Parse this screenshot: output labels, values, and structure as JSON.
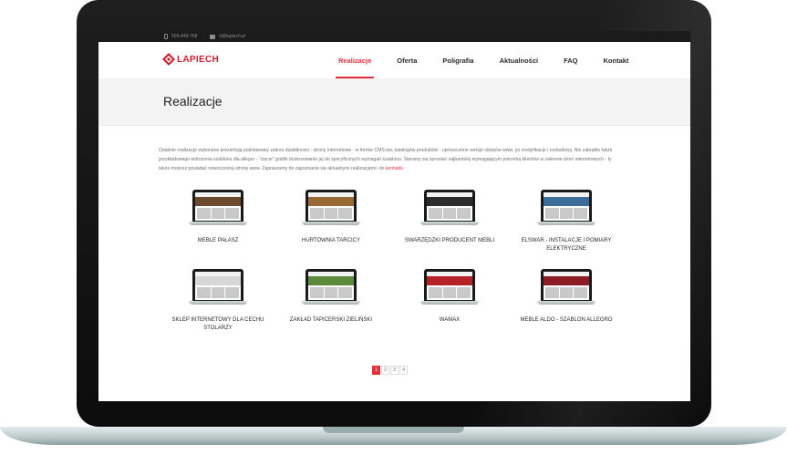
{
  "topbar": {
    "phone": "503-449-768",
    "email": "it@lapiech.pl"
  },
  "logo": {
    "text": "LAPIECH"
  },
  "nav": [
    {
      "label": "Realizacje",
      "active": true
    },
    {
      "label": "Oferta",
      "active": false
    },
    {
      "label": "Poligrafia",
      "active": false
    },
    {
      "label": "Aktualności",
      "active": false
    },
    {
      "label": "FAQ",
      "active": false
    },
    {
      "label": "Kontakt",
      "active": false
    }
  ],
  "page": {
    "title": "Realizacje",
    "intro": "Ostatnie realizacje wykonane prezentują podstawowy zakres działalności - strony internetowe - w formie CMS-ów, katalogów produktów - uproszczone wersje sklepów www, po modyfikacje i rozbudowy. Nie zabrakło także przykładowego wdrożenia szablonu dla allegro - \"cięcie\" grafiki dostosowanie jej do specyficznych wymagań szablonu. Staramy się sprostać najbardziej wymagającym potrzebą klientów w zakresie stron internetowych - ty także możesz posiadać nowoczesną stronę www. Zapraszamy do zapoznania się aktualnymi realizacjami i do",
    "intro_link": "kontaktu",
    "intro_end": "."
  },
  "projects": [
    {
      "label": "MEBLE PAŁASZ",
      "band": "#6b4a2e"
    },
    {
      "label": "HURTOWNIA TARCICY",
      "band": "#9a6a35"
    },
    {
      "label": "SWARZĘDZKI PRODUCENT MEBLI",
      "band": "#2b2b2b"
    },
    {
      "label": "ELSWAR - INSTALACJE I POMIARY ELEKTRYCZNE",
      "band": "#3d6d9a"
    },
    {
      "label": "SKLEP INTERNETOWY DLA CECHU STOLARZY",
      "band": "#d7d7d7"
    },
    {
      "label": "ZAKŁAD TAPICERSKI ZIELIŃSKI",
      "band": "#5b8a3a"
    },
    {
      "label": "WAMAX",
      "band": "#b42126"
    },
    {
      "label": "MEBLE ALDO - SZABLON ALLEGRO",
      "band": "#8c1d22"
    }
  ],
  "pagination": [
    "1",
    "2",
    "3",
    "4"
  ],
  "colors": {
    "accent": "#e42f3c",
    "topbar": "#1b1b1b"
  }
}
